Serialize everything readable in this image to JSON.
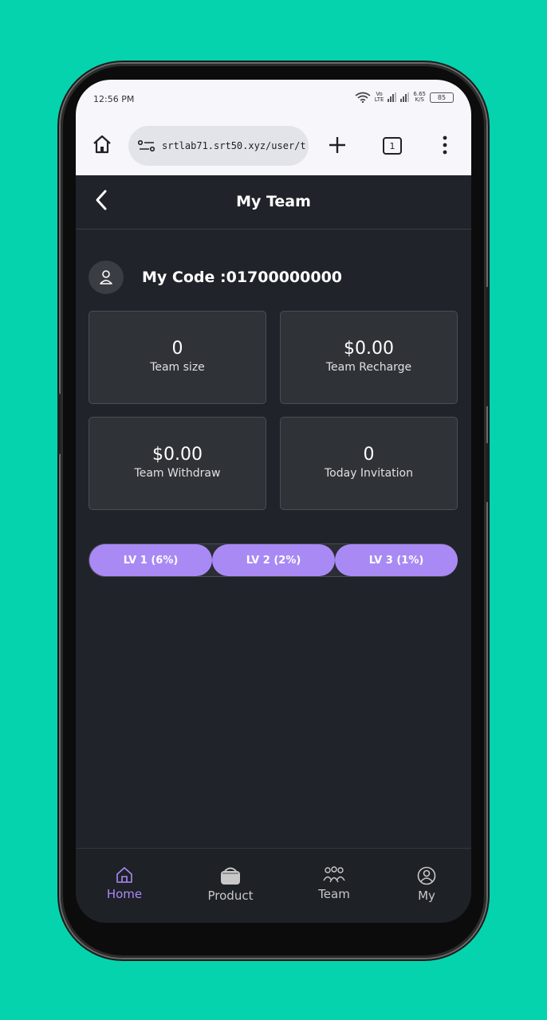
{
  "status_bar": {
    "time": "12:56 PM",
    "network_top": "Vo",
    "network_bottom": "LTE",
    "speed_value": "6.65",
    "speed_unit": "K/S",
    "battery": "85"
  },
  "browser": {
    "url": "srtlab71.srt50.xyz/user/t",
    "tab_count": "1"
  },
  "header": {
    "title": "My Team"
  },
  "code": {
    "label": "My Code :01700000000"
  },
  "stats": [
    {
      "value": "0",
      "label": "Team size"
    },
    {
      "value": "$0.00",
      "label": "Team Recharge"
    },
    {
      "value": "$0.00",
      "label": "Team Withdraw"
    },
    {
      "value": "0",
      "label": "Today Invitation"
    }
  ],
  "levels": [
    {
      "label": "LV 1 (6%)"
    },
    {
      "label": "LV 2 (2%)"
    },
    {
      "label": "LV 3 (1%)"
    }
  ],
  "nav": [
    {
      "label": "Home",
      "icon": "home-icon",
      "active": true
    },
    {
      "label": "Product",
      "icon": "product-icon",
      "active": false
    },
    {
      "label": "Team",
      "icon": "team-icon",
      "active": false
    },
    {
      "label": "My",
      "icon": "user-icon",
      "active": false
    }
  ],
  "colors": {
    "background": "#05d3ad",
    "screen": "#202329",
    "accent": "#a98af5",
    "card": "#2f3237"
  }
}
